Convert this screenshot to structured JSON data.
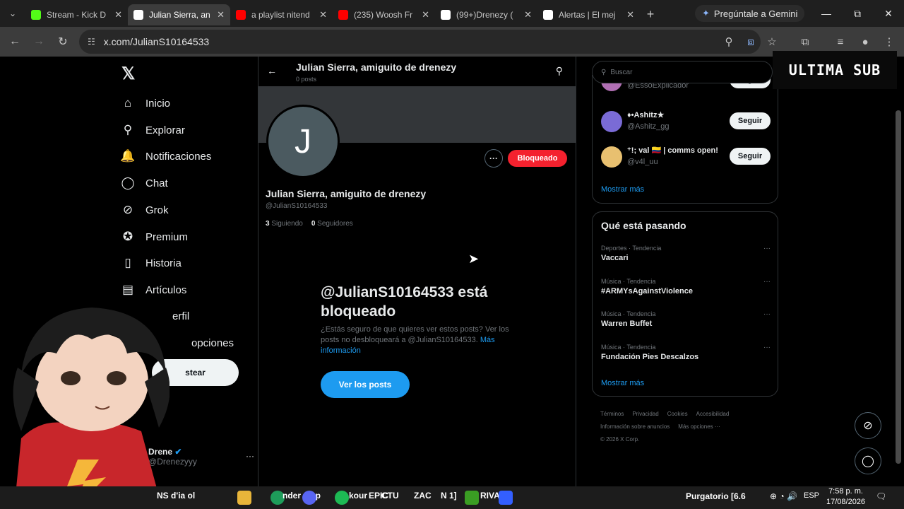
{
  "browser": {
    "tabs": [
      {
        "label": "Stream - Kick D",
        "favicon": "kick-icon",
        "color": "#53fc18",
        "active": false
      },
      {
        "label": "Julian Sierra, an",
        "favicon": "x-icon",
        "color": "#ffffff",
        "active": true
      },
      {
        "label": "a playlist nitend",
        "favicon": "youtube-icon",
        "color": "#ff0000",
        "active": false
      },
      {
        "label": "(235) Woosh Fr",
        "favicon": "youtube-icon",
        "color": "#ff0000",
        "active": false
      },
      {
        "label": "(99+)Drenezy (",
        "favicon": "tiktok-icon",
        "color": "#ffffff",
        "active": false
      },
      {
        "label": "Alertas | El mej",
        "favicon": "streamelements-icon",
        "color": "#ffffff",
        "active": false
      }
    ],
    "gemini_label": "Pregúntale a Gemini",
    "url": "x.com/JulianS10164533"
  },
  "nav": {
    "items": [
      {
        "label": "Inicio",
        "icon": "home-icon",
        "glyph": "⌂"
      },
      {
        "label": "Explorar",
        "icon": "search-icon",
        "glyph": "⚲"
      },
      {
        "label": "Notificaciones",
        "icon": "bell-icon",
        "glyph": "🔔"
      },
      {
        "label": "Chat",
        "icon": "chat-icon",
        "glyph": "◯"
      },
      {
        "label": "Grok",
        "icon": "grok-icon",
        "glyph": "⊘"
      },
      {
        "label": "Premium",
        "icon": "premium-icon",
        "glyph": "✪"
      },
      {
        "label": "Historia",
        "icon": "bookmark-icon",
        "glyph": "▯"
      },
      {
        "label": "Artículos",
        "icon": "articles-icon",
        "glyph": "▤"
      },
      {
        "label": "erfil",
        "icon": "profile-icon",
        "glyph": ""
      },
      {
        "label": "opciones",
        "icon": "more-icon",
        "glyph": ""
      }
    ],
    "post_label": "stear",
    "account_name": "Drene",
    "account_handle": "Drenezyyy"
  },
  "profile": {
    "header_name": "Julian Sierra, amiguito de drenezy",
    "header_posts": "0 posts",
    "avatar_letter": "J",
    "blocked_label": "Bloqueado",
    "name": "Julian Sierra, amiguito de drenezy",
    "handle": "@JulianS10164533",
    "following_count": "3",
    "following_label": "Siguiendo",
    "followers_count": "0",
    "followers_label": "Seguidores",
    "blocked_title": "@JulianS10164533 está bloqueado",
    "blocked_text": "¿Estás seguro de que quieres ver estos posts? Ver los posts no desbloqueará a @JulianS10164533.",
    "blocked_link": "Más información",
    "see_posts_label": "Ver los posts"
  },
  "sidebar": {
    "search_placeholder": "Buscar",
    "who_to_follow": [
      {
        "name": "",
        "handle": "@EssoExplicador",
        "button": "Seguir",
        "avatar_color": "#b06fb3"
      },
      {
        "name": "♦•Ashitz★",
        "handle": "@Ashitz_gg",
        "button": "Seguir",
        "avatar_color": "#7a6bd6"
      },
      {
        "name": "⁺!; val 🇨🇴 | comms open!",
        "handle": "@v4l_uu",
        "button": "Seguir",
        "avatar_color": "#e8c070"
      }
    ],
    "show_more": "Mostrar más",
    "trending_title": "Qué está pasando",
    "trends": [
      {
        "meta": "Deportes · Tendencia",
        "name": "Vaccari"
      },
      {
        "meta": "Música · Tendencia",
        "name": "#ARMYsAgainstViolence"
      },
      {
        "meta": "Música · Tendencia",
        "name": "Warren Buffet"
      },
      {
        "meta": "Música · Tendencia",
        "name": "Fundación Pies Descalzos"
      }
    ],
    "trends_show_more": "Mostrar más",
    "footer": [
      "Términos",
      "Privacidad",
      "Cookies",
      "Accesibilidad",
      "Información sobre anuncios",
      "Más opciones ···",
      "© 2026 X Corp."
    ]
  },
  "overlay_text": "ULTIMA SUB",
  "taskbar": {
    "left_text": "NS d'ia ol",
    "item2": "nder de p",
    "item3": "kour",
    "item4": "CTU",
    "item5": "ZAC",
    "item6": "N 1]",
    "item7": "RIVA",
    "media": "Purgatorio [6.6",
    "lang": "ESP",
    "time": "7:58 p. m.",
    "date": "17/08/2026"
  }
}
